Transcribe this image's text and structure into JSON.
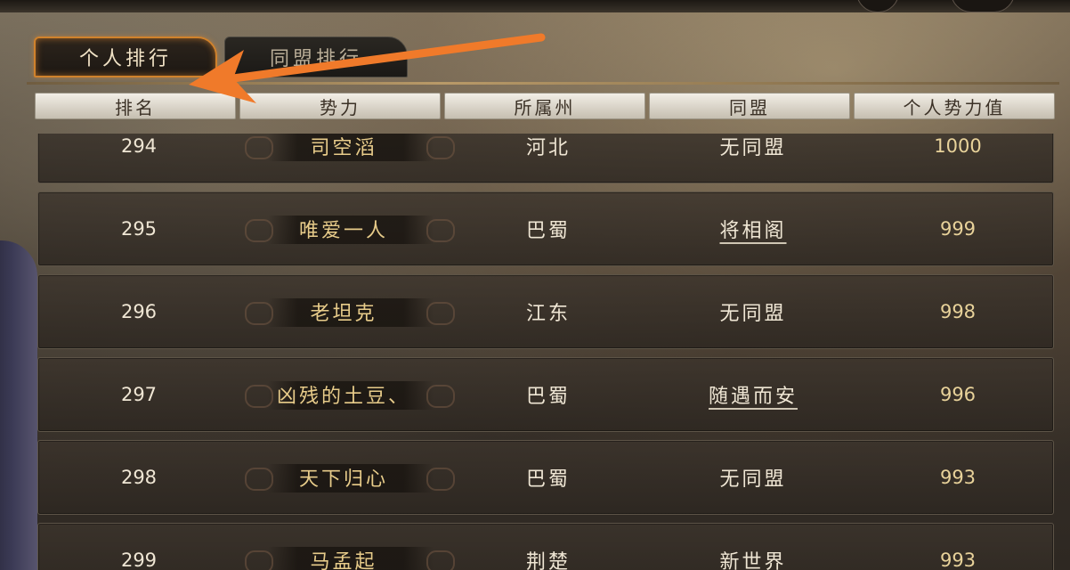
{
  "tabs": {
    "personal_ranking": "个人排行",
    "alliance_ranking": "同盟排行"
  },
  "columns": {
    "rank": "排名",
    "faction": "势力",
    "state": "所属州",
    "alliance": "同盟",
    "personal_power": "个人势力值"
  },
  "rows": [
    {
      "rank": "294",
      "name": "司空滔",
      "state": "河北",
      "alliance": "无同盟",
      "power": "1000"
    },
    {
      "rank": "295",
      "name": "唯爱一人",
      "state": "巴蜀",
      "alliance": "将相阁",
      "power": "999"
    },
    {
      "rank": "296",
      "name": "老坦克",
      "state": "江东",
      "alliance": "无同盟",
      "power": "998"
    },
    {
      "rank": "297",
      "name": "凶残的土豆、",
      "state": "巴蜀",
      "alliance": "随遇而安",
      "power": "996"
    },
    {
      "rank": "298",
      "name": "天下归心",
      "state": "巴蜀",
      "alliance": "无同盟",
      "power": "993"
    },
    {
      "rank": "299",
      "name": "马孟起",
      "state": "荆楚",
      "alliance": "新世界",
      "power": "993"
    }
  ],
  "colors": {
    "accent": "#d0822c",
    "annotation_arrow": "#f07a2a",
    "name_text": "#e8cc8a"
  }
}
